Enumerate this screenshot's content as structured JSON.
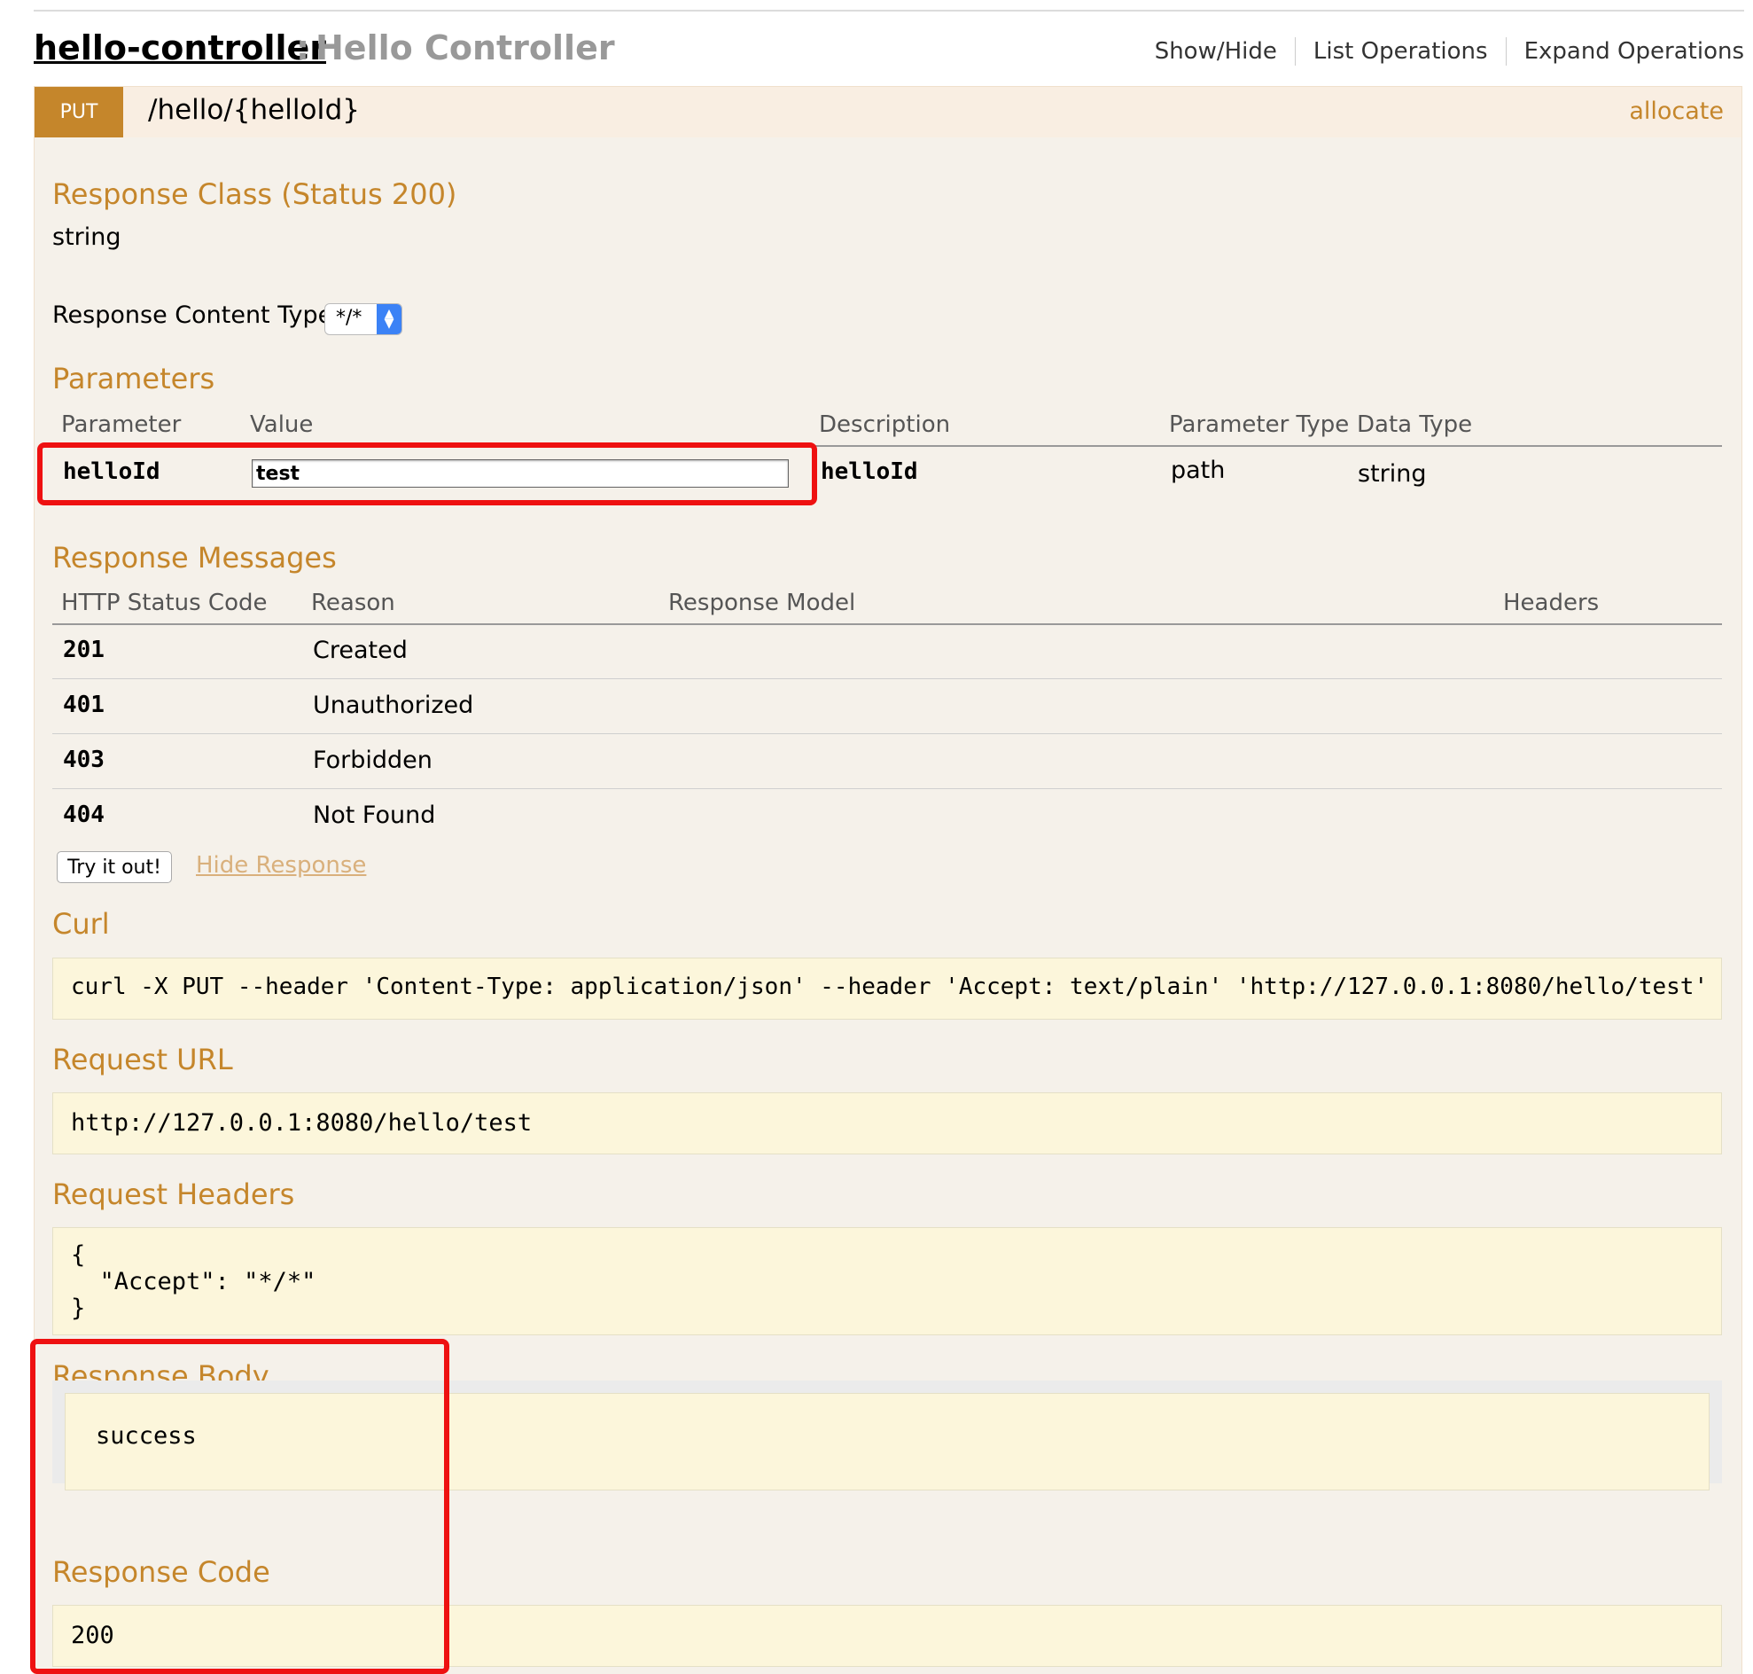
{
  "header": {
    "controller_name": "hello-controller",
    "separator": ":",
    "controller_description": "Hello Controller",
    "links": [
      "Show/Hide",
      "List Operations",
      "Expand Operations"
    ]
  },
  "operation": {
    "method": "PUT",
    "path": "/hello/{helloId}",
    "summary": "allocate"
  },
  "response_class": {
    "heading": "Response Class (Status 200)",
    "type": "string"
  },
  "response_content_type": {
    "label": "Response Content Type",
    "selected": "*/*"
  },
  "parameters": {
    "heading": "Parameters",
    "columns": [
      "Parameter",
      "Value",
      "Description",
      "Parameter Type",
      "Data Type"
    ],
    "rows": [
      {
        "name": "helloId",
        "value": "test",
        "description": "helloId",
        "param_type": "path",
        "data_type": "string"
      }
    ]
  },
  "response_messages": {
    "heading": "Response Messages",
    "columns": [
      "HTTP Status Code",
      "Reason",
      "Response Model",
      "Headers"
    ],
    "rows": [
      {
        "code": "201",
        "reason": "Created"
      },
      {
        "code": "401",
        "reason": "Unauthorized"
      },
      {
        "code": "403",
        "reason": "Forbidden"
      },
      {
        "code": "404",
        "reason": "Not Found"
      }
    ]
  },
  "actions": {
    "try_label": "Try it out!",
    "hide_label": "Hide Response"
  },
  "curl": {
    "heading": "Curl",
    "command": "curl -X PUT --header 'Content-Type: application/json' --header 'Accept: text/plain' 'http://127.0.0.1:8080/hello/test'"
  },
  "request_url": {
    "heading": "Request URL",
    "value": "http://127.0.0.1:8080/hello/test"
  },
  "request_headers": {
    "heading": "Request Headers",
    "value": "{\n  \"Accept\": \"*/*\"\n}"
  },
  "response_body": {
    "heading": "Response Body",
    "value": "success"
  },
  "response_code": {
    "heading": "Response Code",
    "value": "200"
  },
  "colors": {
    "put_badge": "#c5862b",
    "heading": "#c5862b",
    "highlight": "#ee1111",
    "code_block": "#fcf6db"
  }
}
